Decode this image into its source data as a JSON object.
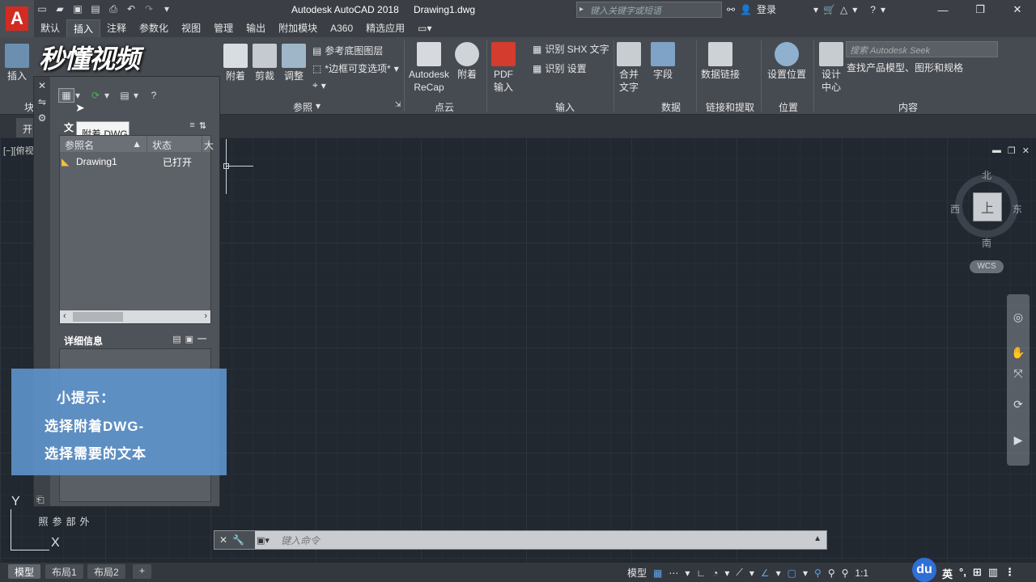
{
  "window": {
    "app_title": "Autodesk AutoCAD 2018",
    "file_name": "Drawing1.dwg",
    "search_placeholder": "键入关键字或短语",
    "signin_label": "登录"
  },
  "ribbon_tabs": [
    "默认",
    "插入",
    "注释",
    "参数化",
    "视图",
    "管理",
    "输出",
    "附加模块",
    "A360",
    "精选应用"
  ],
  "ribbon_active_tab": "插入",
  "ribbon": {
    "insert_label": "插入",
    "attach_label": "附着",
    "clip_label": "剪裁",
    "adjust_label": "调整",
    "ref_underlay_label": "参考底图图层",
    "frame_label": "*边框可变选项*",
    "reference_panel": "参照",
    "recap_label": "Autodesk ReCap",
    "attach2_label": "附着",
    "pointcloud_panel": "点云",
    "pdf_label": "PDF 输入",
    "shx_label": "识别 SHX 文字",
    "recog_settings_label": "识别 设置",
    "import_panel": "输入",
    "merge_text_label": "合并 文字",
    "field_label": "字段",
    "data_panel": "数据",
    "data_link_label": "数据链接",
    "link_panel": "链接和提取",
    "set_location_label": "设置位置",
    "location_panel": "位置",
    "design_center_label": "设计 中心",
    "seek_placeholder": "搜索 Autodesk Seek",
    "seek_text": "查找产品模型、图形和规格",
    "content_panel": "内容",
    "block_panel": "块"
  },
  "watermark": "秒懂视频",
  "file_tab": "开",
  "viewport_label": "[−][俯视",
  "palette": {
    "tooltip": "附着 DWG",
    "file_refs_header": "文",
    "col_ref_name": "参照名",
    "col_status": "状态",
    "col_more": "大",
    "row_name": "Drawing1",
    "row_status": "已打开",
    "details_header": "详细信息",
    "vertical_title": "外部参照"
  },
  "tip": {
    "line1": "小提示：",
    "line2": "选择附着DWG-",
    "line3": "选择需要的文本"
  },
  "viewcube": {
    "north": "北",
    "south": "南",
    "east": "东",
    "west": "西",
    "top": "上",
    "wcs": "WCS"
  },
  "ucs": {
    "x": "X",
    "y": "Y"
  },
  "command": {
    "placeholder": "键入命令"
  },
  "layout_tabs": [
    "模型",
    "布局1",
    "布局2"
  ],
  "status": {
    "model_label": "模型",
    "scale_label": "1:1",
    "ime_label": "英"
  },
  "colors": {
    "app_red": "#d22b22",
    "tip_blue": "#5e96cf",
    "canvas_bg": "#212830"
  }
}
